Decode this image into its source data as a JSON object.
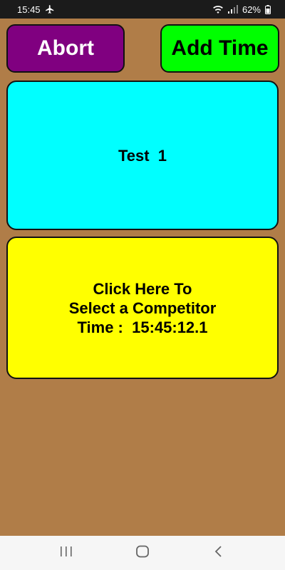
{
  "status_bar": {
    "time": "15:45",
    "battery": "62%",
    "icons": [
      "airplane-mode-icon",
      "wifi-icon",
      "signal-icon",
      "battery-icon"
    ]
  },
  "toolbar": {
    "abort_label": "Abort",
    "add_time_label": "Add Time"
  },
  "event_panel": {
    "label": "Test  1"
  },
  "select_panel": {
    "line1": "Click Here To",
    "line2": "Select a Competitor",
    "time_label": "Time :  15:45:12.1"
  },
  "nav_bar": {
    "icons": [
      "recent-apps-icon",
      "home-icon",
      "back-icon"
    ]
  },
  "colors": {
    "background": "#B07D48",
    "abort": "#800080",
    "add_time": "#00FF00",
    "event_panel": "#00FFFF",
    "select_panel": "#FFFF00"
  }
}
